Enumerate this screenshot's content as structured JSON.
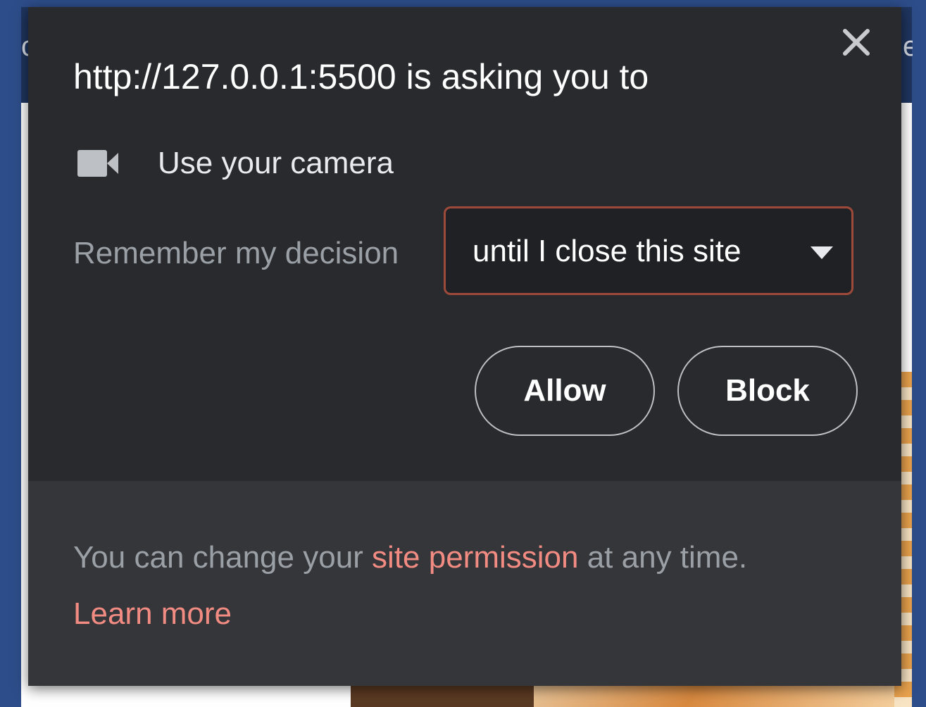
{
  "dialog": {
    "title": "http://127.0.0.1:5500 is asking you to",
    "close_icon": "close-icon",
    "permission": {
      "icon": "camera-icon",
      "label": "Use your camera"
    },
    "remember": {
      "label": "Remember my decision",
      "selected_option": "until I close this site",
      "caret_icon": "caret-down-icon"
    },
    "buttons": {
      "allow": "Allow",
      "block": "Block"
    },
    "footer": {
      "text_before": "You can change your ",
      "link": "site permission",
      "text_after": " at any time.",
      "learn_more": "Learn more"
    }
  },
  "colors": {
    "dialog_bg": "#292a2d",
    "footer_bg": "#35363a",
    "link": "#f28b82",
    "select_border": "#9e4a3a",
    "page_bg": "#2d4d8a"
  }
}
